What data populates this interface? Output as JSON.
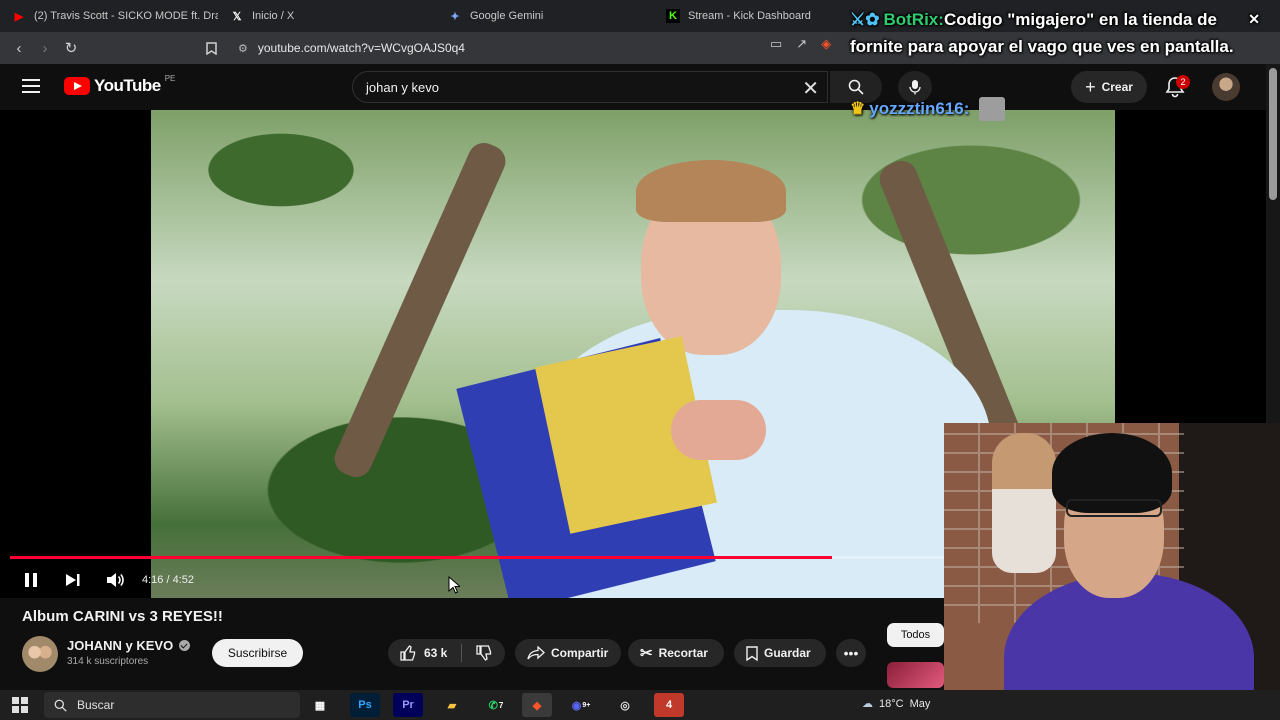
{
  "browser": {
    "tabs": [
      {
        "title": "(2) Travis Scott - SICKO MODE ft. Dra",
        "icon": "youtube-icon",
        "color": "#ff0000"
      },
      {
        "title": "Inicio / X",
        "icon": "x-icon",
        "color": "#ffffff"
      },
      {
        "title": "Google Gemini",
        "icon": "gemini-icon",
        "color": "#7aa7ff"
      },
      {
        "title": "Stream - Kick Dashboard",
        "icon": "kick-icon",
        "color": "#53fc18"
      }
    ],
    "url": "youtube.com/watch?v=WCvgOAJS0q4"
  },
  "youtube": {
    "logo_text": "YouTube",
    "region": "PE",
    "search_value": "johan y kevo",
    "create_label": "Crear",
    "notification_count": "2"
  },
  "video": {
    "title": "Album CARINI vs 3 REYES!!",
    "time": "4:16 / 4:52",
    "progress": 0.88
  },
  "channel": {
    "name": "JOHANN y KEVO",
    "subscribers": "314 k suscriptores",
    "subscribe_label": "Suscribirse"
  },
  "actions": {
    "likes": "63 k",
    "share": "Compartir",
    "clip": "Recortar",
    "save": "Guardar"
  },
  "sidebar": {
    "filter_all": "Todos"
  },
  "chat": {
    "message1_user": "BotRix:",
    "message1_text": "Codigo \"migajero\" en la tienda de fornite para apoyar el vago que ves en pantalla.",
    "message2_user": "yozzztin616:"
  },
  "taskbar": {
    "search_placeholder": "Buscar",
    "weather": "18°C",
    "weather_extra": "May",
    "whatsapp_badge": "7",
    "discord_badge": "9+",
    "apps": [
      "task-view",
      "photoshop",
      "premiere",
      "file-explorer",
      "whatsapp",
      "brave",
      "discord",
      "obs",
      "app"
    ]
  },
  "colors": {
    "accent_red": "#ff0033",
    "youtube_red": "#ff0000",
    "hoodie_purple": "#4b36a8"
  }
}
